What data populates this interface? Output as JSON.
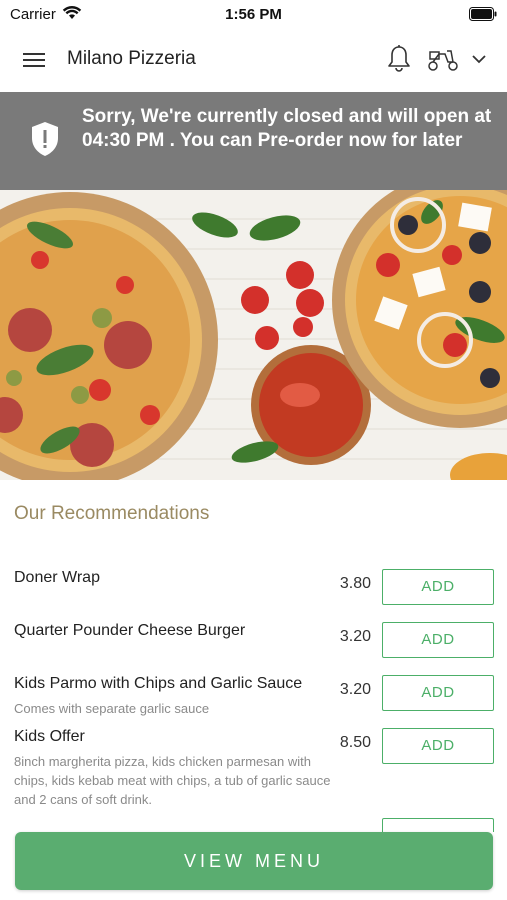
{
  "status_bar": {
    "carrier": "Carrier",
    "time": "1:56 PM"
  },
  "header": {
    "title": "Milano Pizzeria",
    "icons": [
      "menu-icon",
      "bell-icon",
      "delivery-scooter-icon",
      "chevron-down-icon"
    ]
  },
  "banner": {
    "message": "Sorry, We're currently closed and will open at 04:30 PM . You can Pre-order now for later",
    "icon": "shield-alert-icon"
  },
  "recommendations": {
    "title": "Our Recommendations",
    "items": [
      {
        "name": "Doner Wrap",
        "description": "",
        "price": "3.80",
        "add_label": "ADD"
      },
      {
        "name": "Quarter Pounder Cheese Burger",
        "description": "",
        "price": "3.20",
        "add_label": "ADD"
      },
      {
        "name": "Kids Parmo with Chips and Garlic Sauce",
        "description": "Comes with separate garlic sauce",
        "price": "3.20",
        "add_label": "ADD"
      },
      {
        "name": "Kids Offer",
        "description": "8inch margherita pizza, kids chicken parmesan with chips, kids kebab meat with chips, a tub of garlic sauce and 2 cans of soft drink.",
        "price": "8.50",
        "add_label": "ADD"
      }
    ]
  },
  "view_menu": {
    "label": "VIEW MENU"
  },
  "colors": {
    "accent_green": "#5aad70",
    "banner_gray": "#7a7a7a",
    "section_title": "#9a8a62"
  }
}
